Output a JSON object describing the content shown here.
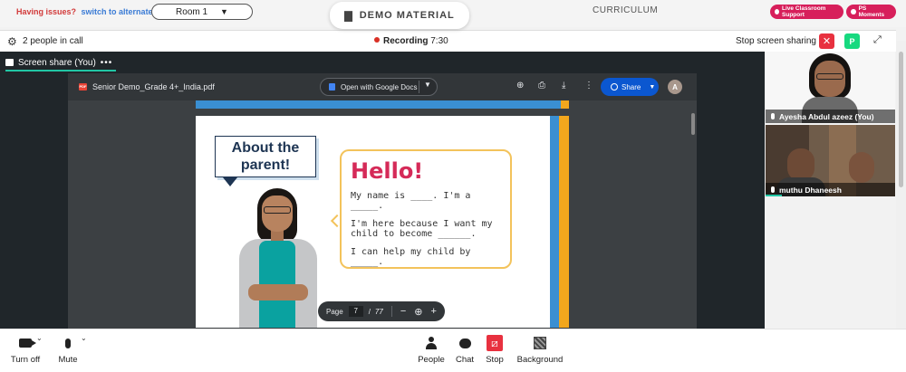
{
  "topbar": {
    "issues_label": "Having issues?",
    "alternate_link": "switch to alternate room",
    "room_select_value": "Room 1",
    "demo_material_label": "DEMO MATERIAL",
    "curriculum_label": "CURRICULUM",
    "live_support_label": "Live Classroom Support",
    "ps_moments_label": "PS Moments"
  },
  "callbar": {
    "people_count": "2 people in call",
    "recording_label": "Recording",
    "recording_time": "7:30",
    "stop_sharing_label": "Stop screen sharing",
    "p_badge": "P",
    "close_glyph": "✕",
    "expand_glyph": "⤢"
  },
  "share": {
    "tab_label": "Screen share (You)",
    "tab_more": "•••"
  },
  "pdf": {
    "badge": "PDF",
    "file_name": "Senior Demo_Grade 4+_India.pdf",
    "open_with_label": "Open with Google Docs",
    "share_label": "Share",
    "account_initial": "A",
    "page_label": "Page",
    "page_current": "7",
    "page_separator": "/",
    "page_total": "77"
  },
  "slide": {
    "about_line1": "About the",
    "about_line2": "parent!",
    "hello": "Hello!",
    "line1": "My name is ____. I'm a _____.",
    "line2": "I'm here because I want my child to become ______.",
    "line3": "I can help my child by _____."
  },
  "participants": [
    {
      "name": "Ayesha Abdul azeez (You)"
    },
    {
      "name": "muthu Dhaneesh"
    }
  ],
  "toolbar": {
    "camera_label": "Turn off",
    "mic_label": "Mute",
    "people_label": "People",
    "chat_label": "Chat",
    "stop_label": "Stop",
    "background_label": "Background"
  },
  "colors": {
    "accent_teal": "#21c6a5",
    "stop_red": "#e8313f",
    "pill_pink": "#d71f5b",
    "share_blue": "#0b57d0",
    "hello_red": "#d52a58"
  },
  "icons": [
    "gear-icon",
    "record-dot-icon",
    "close-icon",
    "expand-icon",
    "screen-share-icon",
    "pdf-icon",
    "doc-icon",
    "add-to-drive-icon",
    "print-icon",
    "download-icon",
    "more-vert-icon",
    "globe-icon",
    "zoom-out-icon",
    "zoom-in-icon",
    "camera-icon",
    "microphone-icon",
    "people-icon",
    "chat-icon",
    "stop-share-icon",
    "background-icon",
    "folder-icon"
  ]
}
